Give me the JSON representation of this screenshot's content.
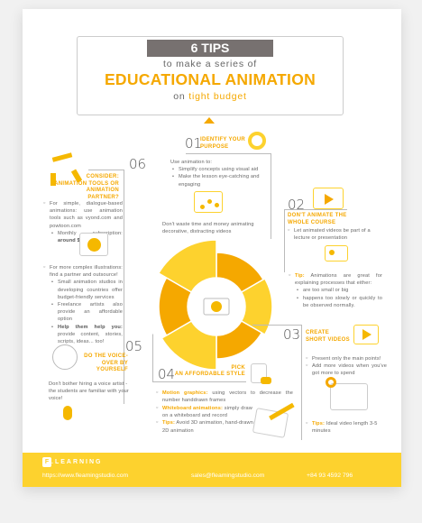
{
  "header": {
    "badge": "6 TIPS",
    "line1": "to make a series of",
    "title": "EDUCATIONAL ANIMATION",
    "line3_prefix": "on",
    "line3_accent": "tight budget"
  },
  "tip01": {
    "num": "01",
    "heading": "IDENTIFY YOUR PURPOSE",
    "intro": "Use animation to:",
    "bullets": [
      "Simplify concepts using visual aid",
      "Make the lesson eye-catching and engaging"
    ],
    "note": "Don't waste time and money animating decorative, distracting videos"
  },
  "tip02": {
    "num": "02",
    "heading": "DON'T ANIMATE THE WHOLE COURSE",
    "text": "Let animated videos be part of a lecture or presentation",
    "tip_label": "Tip:",
    "tip_text": "Animations are great for explaining processes that either:",
    "bullets": [
      "are too small or big",
      "happens too slowly or quickly to be observed normally."
    ]
  },
  "tip03": {
    "num": "03",
    "heading": "CREATE SHORT VIDEOS",
    "points": [
      "Present only the main points!",
      "Add more videos when you've got more to spend"
    ],
    "tip_label": "Tips:",
    "tip_text": "Ideal video length 3-5 minutes"
  },
  "tip04": {
    "num": "04",
    "heading_top": "PICK",
    "heading": "AN AFFORDABLE STYLE",
    "items": [
      {
        "label": "Motion graphics:",
        "text": "using vectors to decrease the number handdrawn frames"
      },
      {
        "label": "Whiteboard animations:",
        "text": "simply draw on a whiteboard and record"
      },
      {
        "label": "Tips:",
        "text": "Avoid 3D animation, hand-drawn 2D animation"
      }
    ]
  },
  "tip05": {
    "num": "05",
    "heading": "DO THE VOICE-OVER BY YOURSELF",
    "text": "Don't bother hiring a voice artist - the students are familiar with your voice!"
  },
  "tip06": {
    "num": "06",
    "heading": "CONSIDER: ANIMATION TOOLS OR ANIMATION PARTNER?",
    "simple": "For simple, dialogue-based animations: use animation tools such as vyond.com and powtoon.com",
    "sub_label": "Monthly subscription:",
    "sub_value": "around $30",
    "complex": "For more complex illustrations: find a partner and outsource!",
    "bullets": [
      "Small animation studios in developing countries offer budget-friendly services",
      "Freelance artists also provide an affordable option"
    ],
    "help_label": "Help them help you:",
    "help_text": "provide content, stories, scripts, ideas... too!"
  },
  "footer": {
    "logo_letter": "F",
    "logo_text": ".LEARNING",
    "website": "https://www.fleamingstudio.com",
    "email": "sales@fleamingstudio.com",
    "phone": "+84 93 4592 796"
  },
  "colors": {
    "accent": "#f5a800",
    "footer": "#fdd22e"
  }
}
